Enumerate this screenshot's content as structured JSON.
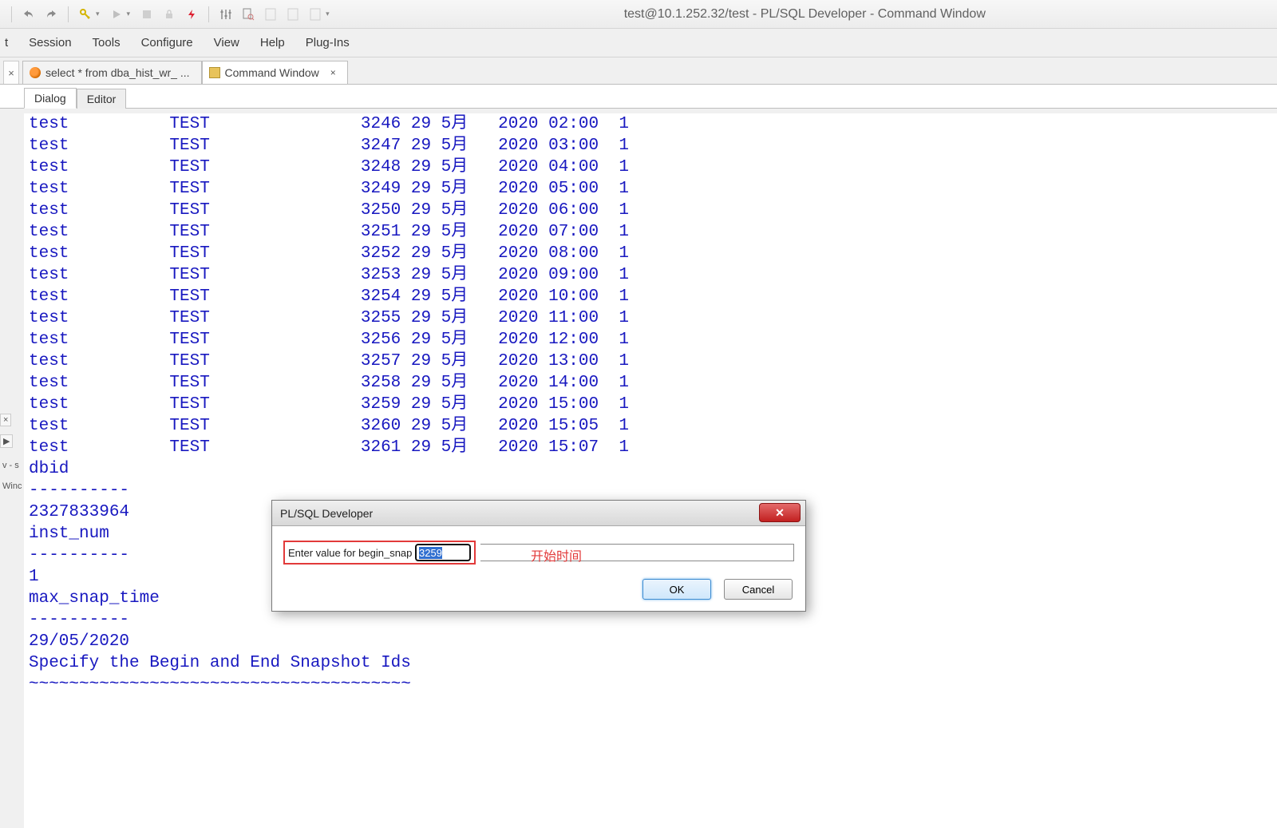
{
  "app_title": "test@10.1.252.32/test - PL/SQL Developer - Command Window",
  "menus": [
    "t",
    "Session",
    "Tools",
    "Configure",
    "View",
    "Help",
    "Plug-Ins"
  ],
  "doc_tabs": [
    {
      "label": "select * from dba_hist_wr_ ...",
      "active": false
    },
    {
      "label": "Command Window",
      "active": true
    }
  ],
  "inner_tabs": [
    {
      "label": "Dialog",
      "active": true
    },
    {
      "label": "Editor",
      "active": false
    }
  ],
  "gutter": {
    "x_top": "×",
    "nav": "▶",
    "v_s": "v - s",
    "winc": "Winc"
  },
  "rows": [
    {
      "c1": "test",
      "c2": "TEST",
      "c3": "3246",
      "c4": "29",
      "c5": "5月",
      "c6": "2020",
      "c7": "02:00",
      "c8": "1"
    },
    {
      "c1": "test",
      "c2": "TEST",
      "c3": "3247",
      "c4": "29",
      "c5": "5月",
      "c6": "2020",
      "c7": "03:00",
      "c8": "1"
    },
    {
      "c1": "test",
      "c2": "TEST",
      "c3": "3248",
      "c4": "29",
      "c5": "5月",
      "c6": "2020",
      "c7": "04:00",
      "c8": "1"
    },
    {
      "c1": "test",
      "c2": "TEST",
      "c3": "3249",
      "c4": "29",
      "c5": "5月",
      "c6": "2020",
      "c7": "05:00",
      "c8": "1"
    },
    {
      "c1": "test",
      "c2": "TEST",
      "c3": "3250",
      "c4": "29",
      "c5": "5月",
      "c6": "2020",
      "c7": "06:00",
      "c8": "1"
    },
    {
      "c1": "test",
      "c2": "TEST",
      "c3": "3251",
      "c4": "29",
      "c5": "5月",
      "c6": "2020",
      "c7": "07:00",
      "c8": "1"
    },
    {
      "c1": "test",
      "c2": "TEST",
      "c3": "3252",
      "c4": "29",
      "c5": "5月",
      "c6": "2020",
      "c7": "08:00",
      "c8": "1"
    },
    {
      "c1": "test",
      "c2": "TEST",
      "c3": "3253",
      "c4": "29",
      "c5": "5月",
      "c6": "2020",
      "c7": "09:00",
      "c8": "1"
    },
    {
      "c1": "test",
      "c2": "TEST",
      "c3": "3254",
      "c4": "29",
      "c5": "5月",
      "c6": "2020",
      "c7": "10:00",
      "c8": "1"
    },
    {
      "c1": "test",
      "c2": "TEST",
      "c3": "3255",
      "c4": "29",
      "c5": "5月",
      "c6": "2020",
      "c7": "11:00",
      "c8": "1"
    },
    {
      "c1": "test",
      "c2": "TEST",
      "c3": "3256",
      "c4": "29",
      "c5": "5月",
      "c6": "2020",
      "c7": "12:00",
      "c8": "1"
    },
    {
      "c1": "test",
      "c2": "TEST",
      "c3": "3257",
      "c4": "29",
      "c5": "5月",
      "c6": "2020",
      "c7": "13:00",
      "c8": "1"
    },
    {
      "c1": "test",
      "c2": "TEST",
      "c3": "3258",
      "c4": "29",
      "c5": "5月",
      "c6": "2020",
      "c7": "14:00",
      "c8": "1"
    },
    {
      "c1": "test",
      "c2": "TEST",
      "c3": "3259",
      "c4": "29",
      "c5": "5月",
      "c6": "2020",
      "c7": "15:00",
      "c8": "1"
    },
    {
      "c1": "test",
      "c2": "TEST",
      "c3": "3260",
      "c4": "29",
      "c5": "5月",
      "c6": "2020",
      "c7": "15:05",
      "c8": "1"
    },
    {
      "c1": "test",
      "c2": "TEST",
      "c3": "3261",
      "c4": "29",
      "c5": "5月",
      "c6": "2020",
      "c7": "15:07",
      "c8": "1"
    }
  ],
  "tail_lines": [
    "dbid",
    "----------",
    "2327833964",
    "inst_num",
    "----------",
    "1",
    "max_snap_time",
    "----------",
    "29/05/2020",
    "Specify the Begin and End Snapshot Ids",
    "~~~~~~~~~~~~~~~~~~~~~~~~~~~~~~~~~~~~~~"
  ],
  "dialog": {
    "title": "PL/SQL Developer",
    "prompt": "Enter value for begin_snap",
    "value": "3259",
    "annotation": "开始时间",
    "ok": "OK",
    "cancel": "Cancel"
  }
}
